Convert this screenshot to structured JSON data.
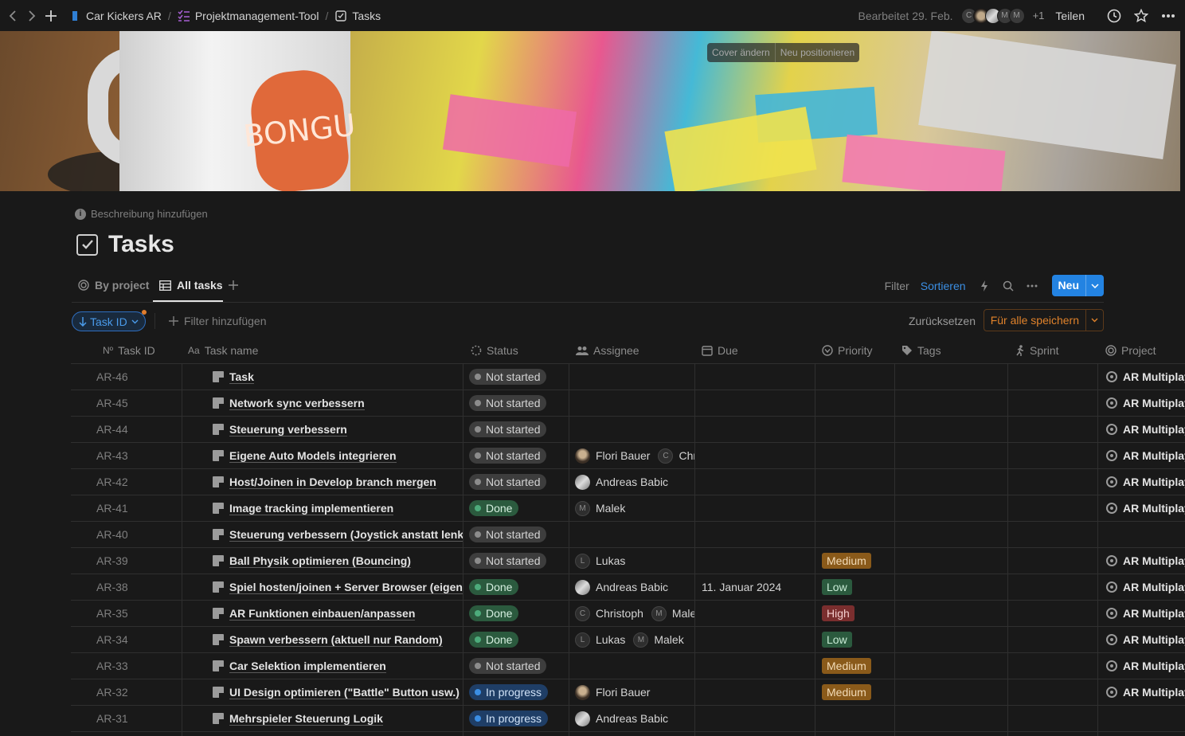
{
  "topbar": {
    "breadcrumbs": [
      "Car Kickers AR",
      "Projektmanagement-Tool",
      "Tasks"
    ],
    "separator": "/",
    "edited": "Bearbeitet 29. Feb.",
    "avatars": [
      "C",
      "",
      "",
      "M",
      "M"
    ],
    "extra_count": "+1",
    "share": "Teilen",
    "icons": [
      "back-icon",
      "forward-icon",
      "plus-icon",
      "clock-icon",
      "star-icon",
      "more-icon"
    ]
  },
  "cover": {
    "change": "Cover ändern",
    "reposition": "Neu positionieren",
    "mug_text": "BONGU"
  },
  "page": {
    "add_description": "Beschreibung hinzufügen",
    "title": "Tasks"
  },
  "views": {
    "tabs": [
      {
        "label": "By project",
        "icon": "target-icon"
      },
      {
        "label": "All tasks",
        "icon": "table-icon"
      }
    ],
    "filter": "Filter",
    "sort": "Sortieren",
    "new": "Neu"
  },
  "filterbar": {
    "chip": "Task ID",
    "add_filter": "Filter hinzufügen",
    "reset": "Zurücksetzen",
    "save_all": "Für alle speichern"
  },
  "columns": [
    "Task ID",
    "Task name",
    "Status",
    "Assignee",
    "Due",
    "Priority",
    "Tags",
    "Sprint",
    "Project"
  ],
  "column_prefix": {
    "id": "Nº",
    "name": "Aa"
  },
  "rows": [
    {
      "id": "AR-46",
      "name": "Task",
      "status": "Not started",
      "assignees": [],
      "due": "",
      "priority": "",
      "project": "AR Multiplayer"
    },
    {
      "id": "AR-45",
      "name": "Network sync verbessern",
      "status": "Not started",
      "assignees": [],
      "due": "",
      "priority": "",
      "project": "AR Multiplayer"
    },
    {
      "id": "AR-44",
      "name": "Steuerung verbessern",
      "status": "Not started",
      "assignees": [],
      "due": "",
      "priority": "",
      "project": "AR Multiplayer"
    },
    {
      "id": "AR-43",
      "name": "Eigene Auto Models integrieren",
      "status": "Not started",
      "assignees": [
        {
          "name": "Flori Bauer",
          "avatar": "photo1"
        },
        {
          "name": "Christoph",
          "avatar": "C"
        }
      ],
      "due": "",
      "priority": "",
      "project": "AR Multiplayer"
    },
    {
      "id": "AR-42",
      "name": "Host/Joinen in Develop branch mergen",
      "status": "Not started",
      "assignees": [
        {
          "name": "Andreas Babic",
          "avatar": "photo2"
        }
      ],
      "due": "",
      "priority": "",
      "project": "AR Multiplayer"
    },
    {
      "id": "AR-41",
      "name": "Image tracking implementieren",
      "status": "Done",
      "assignees": [
        {
          "name": "Malek",
          "avatar": "M"
        }
      ],
      "due": "",
      "priority": "",
      "project": "AR Multiplayer"
    },
    {
      "id": "AR-40",
      "name": "Steuerung verbessern (Joystick anstatt lenkrad)",
      "status": "Not started",
      "assignees": [],
      "due": "",
      "priority": "",
      "project": ""
    },
    {
      "id": "AR-39",
      "name": "Ball Physik optimieren (Bouncing)",
      "status": "Not started",
      "assignees": [
        {
          "name": "Lukas",
          "avatar": "L"
        }
      ],
      "due": "",
      "priority": "Medium",
      "project": "AR Multiplayer"
    },
    {
      "id": "AR-38",
      "name": "Spiel hosten/joinen + Server Browser (eigene Scene)",
      "status": "Done",
      "assignees": [
        {
          "name": "Andreas Babic",
          "avatar": "photo2"
        }
      ],
      "due": "11. Januar 2024",
      "priority": "Low",
      "project": "AR Multiplayer"
    },
    {
      "id": "AR-35",
      "name": "AR Funktionen einbauen/anpassen",
      "status": "Done",
      "assignees": [
        {
          "name": "Christoph",
          "avatar": "C"
        },
        {
          "name": "Malek",
          "avatar": "M"
        }
      ],
      "due": "",
      "priority": "High",
      "project": "AR Multiplayer"
    },
    {
      "id": "AR-34",
      "name": "Spawn verbessern (aktuell nur Random)",
      "status": "Done",
      "assignees": [
        {
          "name": "Lukas",
          "avatar": "L"
        },
        {
          "name": "Malek",
          "avatar": "M"
        }
      ],
      "due": "",
      "priority": "Low",
      "project": "AR Multiplayer"
    },
    {
      "id": "AR-33",
      "name": "Car Selektion implementieren",
      "status": "Not started",
      "assignees": [],
      "due": "",
      "priority": "Medium",
      "project": "AR Multiplayer"
    },
    {
      "id": "AR-32",
      "name": "UI Design optimieren (\"Battle\" Button usw.)",
      "status": "In progress",
      "assignees": [
        {
          "name": "Flori Bauer",
          "avatar": "photo1"
        }
      ],
      "due": "",
      "priority": "Medium",
      "project": "AR Multiplayer"
    },
    {
      "id": "AR-31",
      "name": "Mehrspieler Steuerung Logik",
      "status": "In progress",
      "assignees": [
        {
          "name": "Andreas Babic",
          "avatar": "photo2"
        }
      ],
      "due": "",
      "priority": "",
      "project": ""
    }
  ],
  "colors": {
    "accent": "#2383e2",
    "background": "#191919",
    "status_done": "#4dab7b",
    "status_in_progress": "#3b8ee3",
    "save_orange": "#e0822b"
  }
}
